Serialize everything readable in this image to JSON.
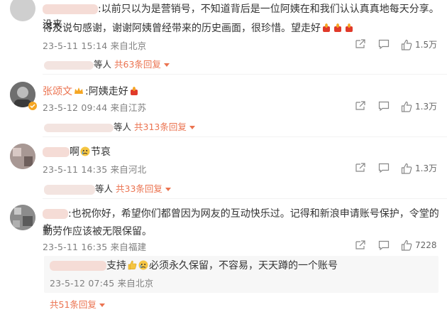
{
  "comments": [
    {
      "text": ":以前只以为是营销号，不知道背后是一位阿姨在和我们认认真真地每天分享。没来",
      "text2": "得及说句感谢，谢谢阿姨曾经带来的历史画面，很珍惜。望走好",
      "time": "23-5-11 15:14",
      "location": "来自北京",
      "likes": "1.5万",
      "replies_prefix": "等人",
      "replies_count": "共63条回复"
    },
    {
      "username": "张颂文",
      "text": ":阿姨走好",
      "time": "23-5-12 09:44",
      "location": "来自江苏",
      "likes": "1.3万",
      "replies_prefix": "等人",
      "replies_count": "共313条回复"
    },
    {
      "text": "啊",
      "text_after": "节哀",
      "time": "23-5-11 14:35",
      "location": "来自河北",
      "likes": "1.3万",
      "replies_prefix": "等人",
      "replies_count": "共33条回复"
    },
    {
      "text": ":也祝你好，希望你们都曾因为网友的互动快乐过。记得和新浪申请账号保护，令堂的辛",
      "text2": "勤劳作应该被无限保留。",
      "time": "23-5-11 16:35",
      "location": "来自福建",
      "likes": "7228",
      "sub_reply": {
        "text_pre": "支持",
        "text_post": "必须永久保留，不容易，天天蹲的一个账号",
        "time": "23-5-12 07:45",
        "location": "来自北京"
      },
      "replies_count": "共51条回复"
    }
  ],
  "colors": {
    "accent": "#eb7350",
    "meta": "#808080"
  },
  "icons": [
    "share-icon",
    "comment-icon",
    "like-icon",
    "chevron-down-icon",
    "candle-emoji",
    "crown-badge-icon",
    "crying-emoji",
    "thumbs-up-emoji"
  ]
}
